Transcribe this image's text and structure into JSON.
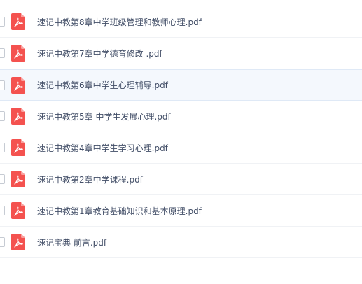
{
  "files": [
    {
      "name": "速记中教第8章中学班级管理和教师心理.pdf",
      "icon": "pdf-file-icon",
      "selected": false
    },
    {
      "name": "速记中教第7章中学德育修改 .pdf",
      "icon": "pdf-file-icon",
      "selected": false
    },
    {
      "name": "速记中教第6章中学生心理辅导.pdf",
      "icon": "pdf-file-icon",
      "selected": true
    },
    {
      "name": "速记中教第5章 中学生发展心理.pdf",
      "icon": "pdf-file-icon",
      "selected": false
    },
    {
      "name": "速记中教第4章中学生学习心理.pdf",
      "icon": "pdf-file-icon",
      "selected": false
    },
    {
      "name": "速记中教第2章中学课程.pdf",
      "icon": "pdf-file-icon",
      "selected": false
    },
    {
      "name": "速记中教第1章教育基础知识和基本原理.pdf",
      "icon": "pdf-file-icon",
      "selected": false
    },
    {
      "name": "速记宝典 前言.pdf",
      "icon": "pdf-file-icon",
      "selected": false
    }
  ],
  "colors": {
    "pdf_icon": "#f4524f",
    "row_selected_bg": "#f4f8fd",
    "text": "#424e67",
    "divider": "#f0f2f5"
  }
}
